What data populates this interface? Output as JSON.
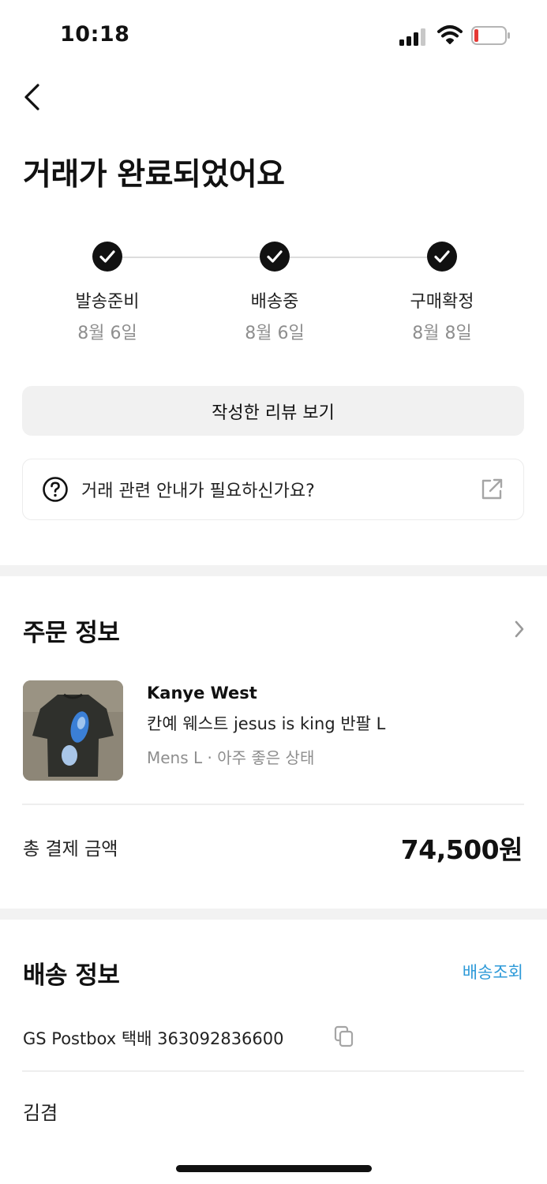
{
  "status_bar": {
    "time": "10:18",
    "battery_color": "#e53935"
  },
  "header": {
    "title": "거래가 완료되었어요",
    "back_icon": "chevron-left-icon"
  },
  "progress": {
    "steps": [
      {
        "label": "발송준비",
        "date": "8월 6일"
      },
      {
        "label": "배송중",
        "date": "8월 6일"
      },
      {
        "label": "구매확정",
        "date": "8월 8일"
      }
    ]
  },
  "actions": {
    "review_label": "작성한 리뷰 보기",
    "guide_label": "거래 관련 안내가 필요하신가요?"
  },
  "order": {
    "title": "주문 정보",
    "brand": "Kanye West",
    "name": "칸예 웨스트 jesus is king 반팔 L",
    "options": "Mens L · 아주 좋은 상태",
    "total_label": "총 결제 금액",
    "total_value": "74,500원"
  },
  "shipping": {
    "title": "배송 정보",
    "track_label": "배송조회",
    "courier": "GS Postbox 택배 363092836600",
    "recipient": "김겸"
  },
  "colors": {
    "accent": "#2e9ad8",
    "check_bg": "#111111",
    "button_bg": "#f1f1f1"
  }
}
